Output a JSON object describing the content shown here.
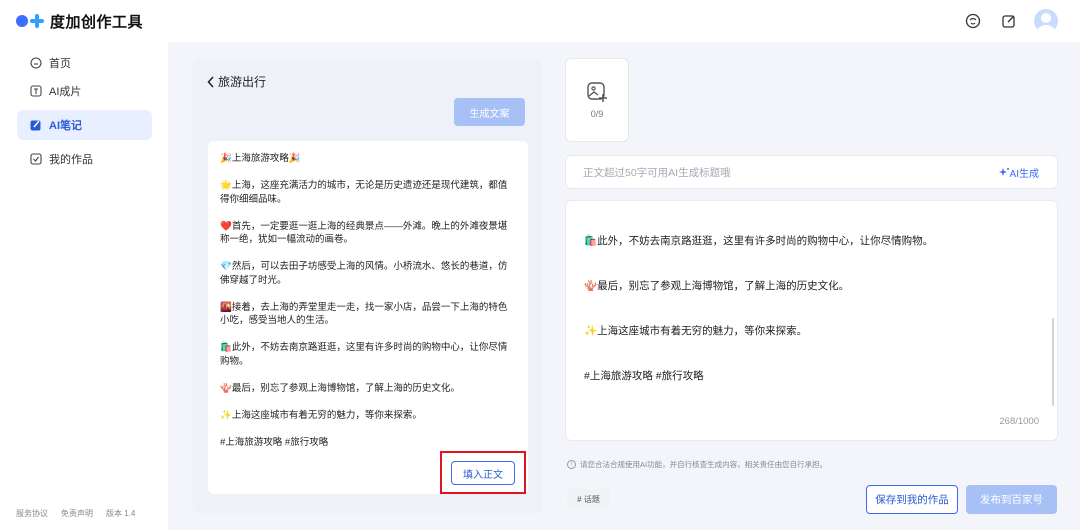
{
  "app": {
    "title": "度加创作工具"
  },
  "sidebar": {
    "items": [
      {
        "label": "首页",
        "icon": "home-icon",
        "active": false
      },
      {
        "label": "AI成片",
        "icon": "text-icon",
        "active": false
      },
      {
        "label": "AI笔记",
        "icon": "pen-icon",
        "active": true
      },
      {
        "label": "我的作品",
        "icon": "check-box-icon",
        "active": false
      }
    ],
    "footer": [
      "服务协议",
      "免责声明",
      "版本 1.4"
    ]
  },
  "ai_panel": {
    "back_label": "旅游出行",
    "generate_button": "生成文案",
    "fill_button": "填入正文",
    "note_paragraphs": [
      "🎉上海旅游攻略🎉",
      "🌟上海，这座充满活力的城市，无论是历史遗迹还是现代建筑，都值得你细细品味。",
      "❤️首先，一定要逛一逛上海的经典景点——外滩。晚上的外滩夜景堪称一绝，犹如一幅流动的画卷。",
      "💎然后，可以去田子坊感受上海的风情。小桥流水、悠长的巷道，仿佛穿越了时光。",
      "🌇接着，去上海的弄堂里走一走，找一家小店，品尝一下上海的特色小吃，感受当地人的生活。",
      "🛍️此外，不妨去南京路逛逛，这里有许多时尚的购物中心，让你尽情购物。",
      "🪸最后，别忘了参观上海博物馆，了解上海的历史文化。",
      "✨上海这座城市有着无穷的魅力，等你来探索。",
      "#上海旅游攻略 #旅行攻略"
    ]
  },
  "editor": {
    "image_count": "0/9",
    "title_placeholder": "正文超过50字可用AI生成标题哦",
    "ai_generate": "AI生成",
    "body_paragraphs": [
      "🛍️此外，不妨去南京路逛逛，这里有许多时尚的购物中心，让你尽情购物。",
      "🪸最后，别忘了参观上海博物馆，了解上海的历史文化。",
      "✨上海这座城市有着无穷的魅力，等你来探索。",
      "#上海旅游攻略 #旅行攻略"
    ],
    "char_count": "268/1000",
    "disclaimer": "请您合法合规使用AI功能，并自行核查生成内容，相关责任由您自行承担。",
    "topic_button": "# 话题",
    "save_button": "保存到我的作品",
    "publish_button": "发布到百家号"
  },
  "colors": {
    "accent": "#3c6df0",
    "accent_light": "#a7c1f6",
    "highlight_box": "#e0141e"
  }
}
